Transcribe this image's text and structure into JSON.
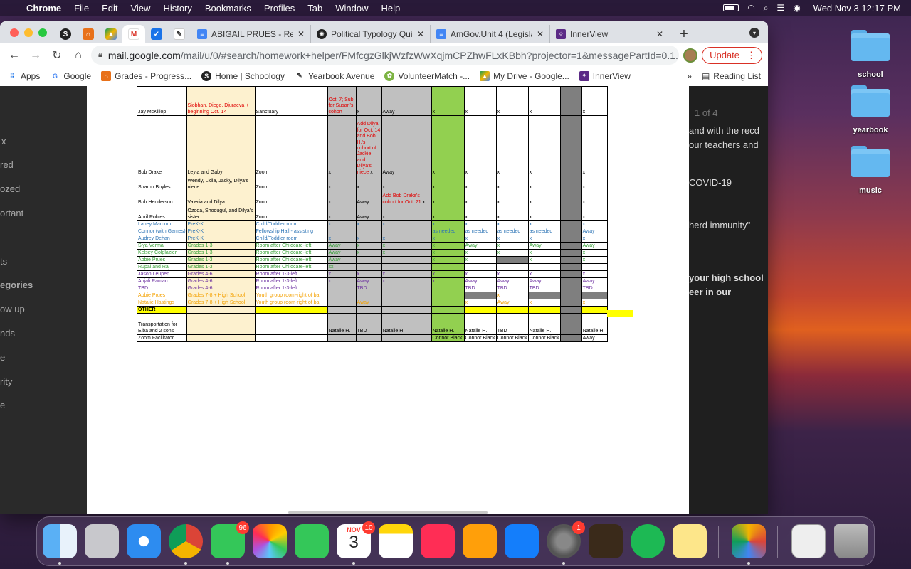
{
  "menubar": {
    "app": "Chrome",
    "items": [
      "File",
      "Edit",
      "View",
      "History",
      "Bookmarks",
      "Profiles",
      "Tab",
      "Window",
      "Help"
    ],
    "clock": "Wed Nov 3  12:17 PM"
  },
  "tabs": [
    {
      "title": "ABIGAIL PRUES - Rea",
      "icon": "docs-icon",
      "color": "#4285f4"
    },
    {
      "title": "Political Typology Qui",
      "icon": "typology-icon",
      "color": "#222222"
    },
    {
      "title": "AmGov.Unit 4 (Legisla",
      "icon": "docs-icon",
      "color": "#4285f4"
    },
    {
      "title": "InnerView",
      "icon": "innerview-icon",
      "color": "#5b2a86"
    }
  ],
  "address": {
    "host": "mail.google.com",
    "path": "/mail/u/0/#search/homework+helper/FMfcgzGlkjWzfzWwXqjmCPZhwFLxKBbh?projector=1&messagePartId=0.1.1",
    "update_label": "Update"
  },
  "bookmarks": [
    {
      "label": "Apps",
      "icon": "apps-grid-icon"
    },
    {
      "label": "Google",
      "icon": "google-icon"
    },
    {
      "label": "Grades - Progress...",
      "icon": "grades-icon"
    },
    {
      "label": "Home | Schoology",
      "icon": "schoology-icon"
    },
    {
      "label": "Yearbook Avenue",
      "icon": "yearbook-icon"
    },
    {
      "label": "VolunteerMatch -...",
      "icon": "volunteermatch-icon"
    },
    {
      "label": "My Drive - Google...",
      "icon": "drive-icon"
    },
    {
      "label": "InnerView",
      "icon": "innerview-icon"
    }
  ],
  "bookmarks_more": "»",
  "reading_list": "Reading List",
  "gmail_left": [
    "x",
    "red",
    "ozed",
    "ortant",
    "ts",
    "egories",
    "ow up",
    "nds",
    "e",
    "rity",
    "e"
  ],
  "gmail_right": {
    "pager": "1 of 4",
    "lines": [
      "and with the recd",
      "our teachers and",
      "COVID-19",
      "herd immunity\"",
      "your high school",
      "eer in our"
    ]
  },
  "schedule": {
    "row_jay": {
      "a": "Jay McKillop",
      "b": "Siobhan, Diego, Djuraeva + beginning Oct. 14",
      "c": "Sanctuary",
      "d": "Oct. 7; Sub for Susan's cohort",
      "e": "x",
      "f": "Away",
      "g": "x",
      "h": "x",
      "i": "x",
      "j": "x",
      "l": "x"
    },
    "row_bob": {
      "a": "Bob Drake",
      "b": "Leyla and Gaby",
      "c": "Zoom",
      "d": "x",
      "e_note": "Add Dilya for Oct. 14 and Bob H.'s cohort of Jackie and Dilya's niece",
      "e": "x",
      "f": "Away",
      "g": "x",
      "h": "x",
      "i": "x",
      "j": "x",
      "l": "x"
    },
    "row_sharon": {
      "a": "Sharon Boyles",
      "b": "Wendy, Lidia, Jacky, Dilya's niece",
      "c": "Zoom",
      "d": "x",
      "e": "x",
      "f": "x",
      "g": "x",
      "h": "x",
      "i": "x",
      "j": "x",
      "l": "x"
    },
    "row_bobh": {
      "a": "Bob Henderson",
      "b": "Valeria and Dilya",
      "c": "Zoom",
      "d": "x",
      "e": "Away",
      "f_note": "Add Bob Drake's cohort for Oct. 21",
      "f": "x",
      "g": "x",
      "h": "x",
      "i": "x",
      "j": "x",
      "l": "x"
    },
    "row_april": {
      "a": "April Robles",
      "b": "Ozoda, Shodugul, and Dilya's sister",
      "c": "Zoom",
      "d": "x",
      "e": "Away",
      "f": "x",
      "g": "x",
      "h": "x",
      "i": "x",
      "j": "x",
      "l": "x"
    },
    "kids": [
      {
        "a": "Laney Marcum",
        "b": "PreK-K",
        "c": "Child/Toddler room",
        "color": "blu",
        "d": "x",
        "e": "x",
        "f": "x",
        "g": "x",
        "h": "x",
        "i": "x",
        "j": "x",
        "l": "x"
      },
      {
        "a": "Connor (with Games)",
        "b": "PreK-K",
        "c": "Fellowship Hall - assisting",
        "color": "blu",
        "d": "",
        "e": "",
        "f": "",
        "g": "as needed",
        "h": "as needed",
        "i": "as needed",
        "j": "as needed",
        "l": "Away"
      },
      {
        "a": "Audrey Dehan",
        "b": "PreK-K",
        "c": "Child/Toddler room",
        "color": "blu",
        "d": "x",
        "e": "x",
        "f": "x",
        "g": "x",
        "h": "x",
        "i": "x",
        "j": "x",
        "l": "x"
      },
      {
        "a": "Siya Verma",
        "b": "Grades 1-3",
        "c": "Room after Childcare-left",
        "color": "grt",
        "d": "Away",
        "e": "x",
        "f": "x",
        "g": "x",
        "h": "Away",
        "i": "x",
        "j": "Away",
        "l": "Away"
      },
      {
        "a": "Kelsey Colglazier",
        "b": "Grades 1-3",
        "c": "Room after Childcare-left",
        "color": "grt",
        "d": "Away",
        "e": "x",
        "f": "x",
        "g": "x",
        "h": "x",
        "i": "x",
        "j": "x",
        "l": "x"
      },
      {
        "a": "Abbie Prues",
        "b": "Grades 1-3",
        "c": "Room after Childcare-left",
        "color": "grt",
        "d": "Away",
        "e": "",
        "f": "",
        "g": "x",
        "h": "x",
        "i": "",
        "j": "x",
        "l": "x"
      },
      {
        "a": "Rupal and Raj",
        "b": "Grades 1-3",
        "c": "Room after Childcare-left",
        "color": "grt",
        "d": "xx",
        "e": "",
        "f": "",
        "g": "",
        "h": "",
        "i": "",
        "j": "",
        "l": ""
      },
      {
        "a": "Jason Leupen",
        "b": "Grades 4-6",
        "c": "Room after 1-3-left",
        "color": "pur",
        "d": "x",
        "e": "x",
        "f": "x",
        "g": "x",
        "h": "x",
        "i": "x",
        "j": "x",
        "l": "x"
      },
      {
        "a": "Anjali Raman",
        "b": "Grades 4-6",
        "c": "Room after 1-3-left",
        "color": "pur",
        "d": "x",
        "e": "Away",
        "f": "x",
        "g": "x",
        "h": "Away",
        "i": "Away",
        "j": "Away",
        "l": "Away"
      },
      {
        "a": "TBD",
        "b": "Grades 4-6",
        "c": "Room after 1-3-left",
        "color": "pur",
        "d": "",
        "e": "TBD",
        "f": "",
        "g": "",
        "h": "TBD",
        "i": "TBD",
        "j": "TBD",
        "l": "TBD"
      },
      {
        "a": "Abbie Prues",
        "b": "Grades 7-8 + High School",
        "c": "Youth group room-right of ba",
        "color": "org",
        "d": "",
        "e": "",
        "f": "",
        "g": "",
        "h": "",
        "i": "x",
        "j": "",
        "l": ""
      },
      {
        "a": "Natalie Hastings",
        "b": "Grades 7-8 + High School",
        "c": "Youth group room-right of ba",
        "color": "org",
        "d": "",
        "e": "Away",
        "f": "",
        "g": "",
        "h": "x",
        "i": "Away",
        "j": "x",
        "l": "x"
      }
    ],
    "other_label": "OTHER",
    "transport": {
      "a": "Transportation for Elba and 2 sons",
      "d": "Natalie H.",
      "e": "TBD",
      "f": "Natalie H.",
      "g": "Natalie H.",
      "h": "Natalie H.",
      "i": "TBD",
      "j": "Natalie H.",
      "l": "Natalie H."
    },
    "zoom": {
      "a": "Zoom Facilitator",
      "g": "Connor Black",
      "h": "Connor Black",
      "i": "Connor Black",
      "j": "Connor Black",
      "l": "Away"
    }
  },
  "desktop_folders": [
    "school",
    "yearbook",
    "music"
  ],
  "dock": {
    "messages_badge": "96",
    "calendar_month": "NOV",
    "calendar_day": "3",
    "calendar_badge": "10",
    "settings_badge": "1"
  }
}
